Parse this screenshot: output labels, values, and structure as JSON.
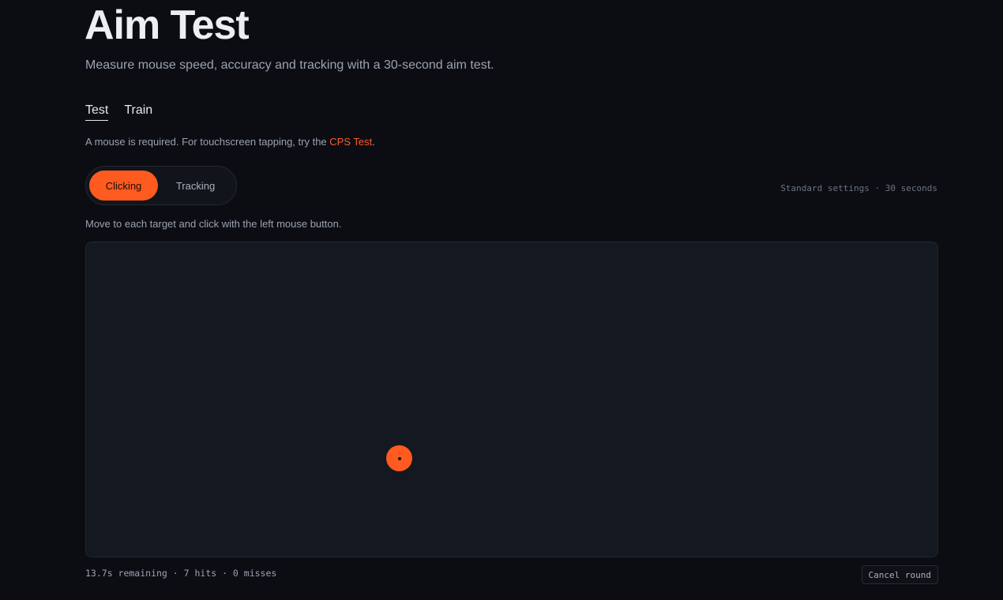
{
  "page": {
    "title": "Aim Test",
    "subtitle": "Measure mouse speed, accuracy and tracking with a 30-second aim test."
  },
  "tabs": [
    {
      "label": "Test",
      "active": true
    },
    {
      "label": "Train",
      "active": false
    }
  ],
  "notice": {
    "text": "A mouse is required. For touchscreen tapping, try the ",
    "link_label": "CPS Test",
    "suffix": "."
  },
  "modes": {
    "clicking_label": "Clicking",
    "tracking_label": "Tracking",
    "selected": "Clicking"
  },
  "settings_text": "Standard settings · 30 seconds",
  "instruction": "Move to each target and click with the left mouse button.",
  "status": {
    "text": "13.7s remaining · 7 hits · 0 misses"
  },
  "cancel_label": "Cancel round",
  "colors": {
    "accent": "#ff5a1f",
    "link": "#ff5a2a",
    "background": "#0b0d12",
    "arena": "#141820"
  }
}
